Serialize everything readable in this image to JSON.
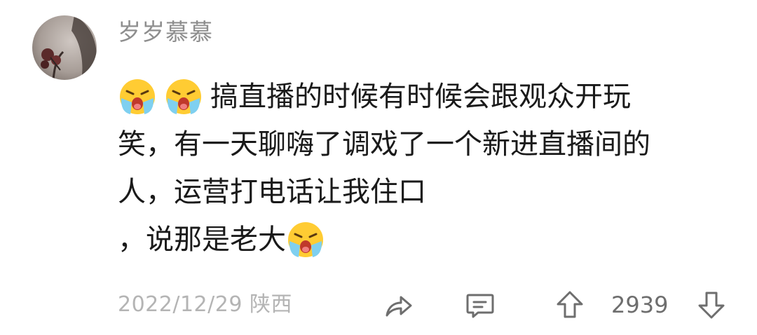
{
  "comment": {
    "username": "岁岁慕慕",
    "line1": "搞直播的时候有时候会跟观众开玩",
    "line2": "笑，有一天聊嗨了调戏了一个新进直播间的",
    "line3": "人，运营打电话让我住口",
    "line4": "，说那是老大",
    "leading_emojis": [
      "crying-face-emoji",
      "crying-face-emoji"
    ],
    "trailing_emoji": "crying-face-emoji",
    "date": "2022/12/29",
    "location": "陕西",
    "upvote_count": "2939"
  },
  "actions": {
    "share_icon": "share-arrow-icon",
    "reply_icon": "comment-bubble-icon",
    "upvote_icon": "upvote-arrow-icon",
    "downvote_icon": "downvote-arrow-icon"
  },
  "colors": {
    "username": "#8e8e8e",
    "body_text": "#1a1a1a",
    "meta_text": "#b4b4b4",
    "count_text": "#6e6e6e",
    "icon_stroke": "#6e6e6e"
  }
}
